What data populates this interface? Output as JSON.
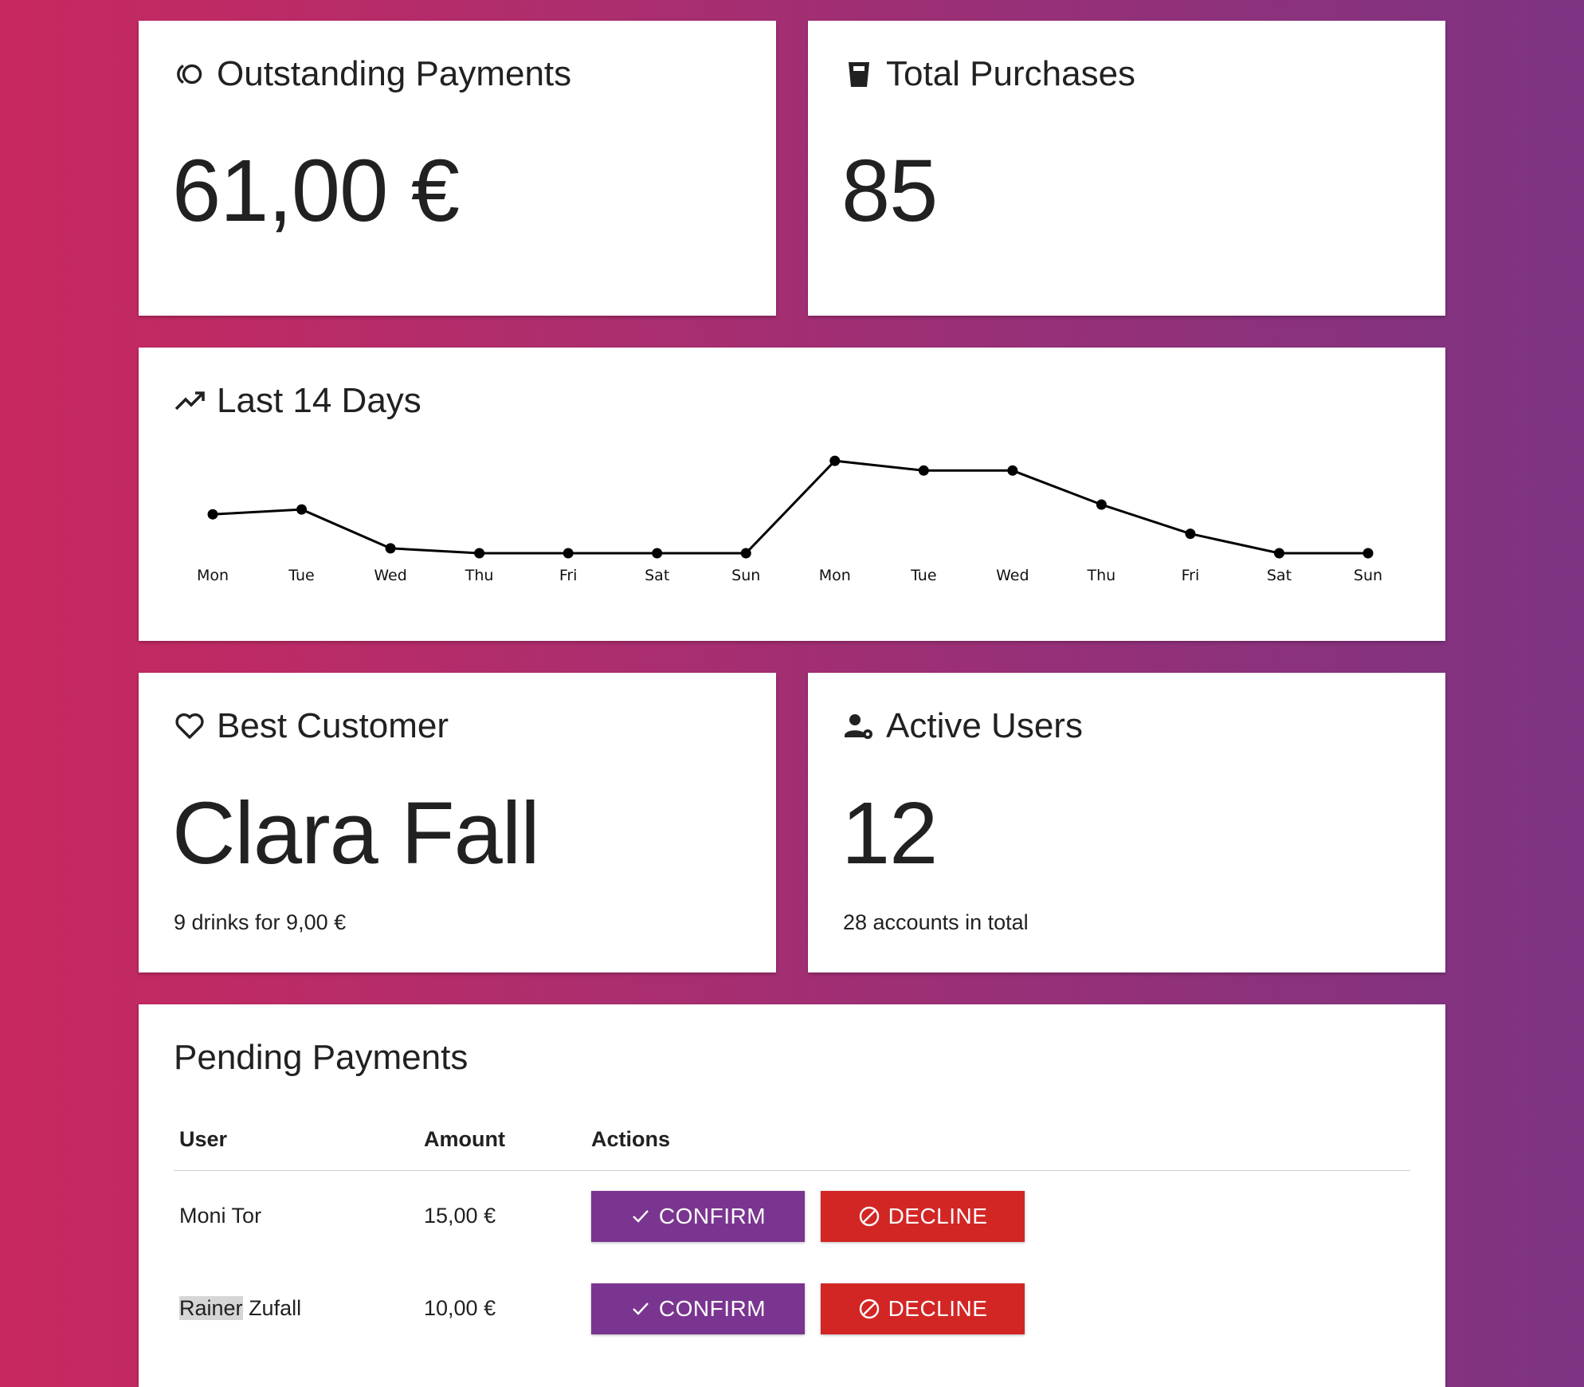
{
  "colors": {
    "confirm": "#7a3590",
    "decline": "#d22625",
    "gradient_start": "#c8285f",
    "gradient_end": "#7d3482"
  },
  "outstanding": {
    "icon": "coins-icon",
    "title": "Outstanding Payments",
    "value": "61,00 €"
  },
  "purchases": {
    "icon": "cup-icon",
    "title": "Total Purchases",
    "value": "85"
  },
  "last_days": {
    "icon": "trending-up-icon",
    "title": "Last 14 Days"
  },
  "chart_data": {
    "type": "line",
    "categories": [
      "Mon",
      "Tue",
      "Wed",
      "Thu",
      "Fri",
      "Sat",
      "Sun",
      "Mon",
      "Tue",
      "Wed",
      "Thu",
      "Fri",
      "Sat",
      "Sun"
    ],
    "values": [
      4,
      4.5,
      0.5,
      0,
      0,
      0,
      0,
      9.5,
      8.5,
      8.5,
      5,
      2,
      0,
      0
    ],
    "ylim": [
      0,
      10
    ],
    "grid": false,
    "legend": "none"
  },
  "best_customer": {
    "icon": "heart-icon",
    "title": "Best Customer",
    "name": "Clara Fall",
    "detail": "9 drinks for 9,00 €"
  },
  "active_users": {
    "icon": "user-gear-icon",
    "title": "Active Users",
    "value": "12",
    "detail": "28 accounts in total"
  },
  "pending": {
    "title": "Pending Payments",
    "columns": {
      "user": "User",
      "amount": "Amount",
      "actions": "Actions"
    },
    "rows": [
      {
        "user_first": "Moni",
        "user_last": "Tor",
        "amount": "15,00 €",
        "confirm": "CONFIRM",
        "decline": "DECLINE"
      },
      {
        "user_first": "Rainer",
        "user_last": "Zufall",
        "amount": "10,00 €",
        "confirm": "CONFIRM",
        "decline": "DECLINE"
      }
    ]
  }
}
